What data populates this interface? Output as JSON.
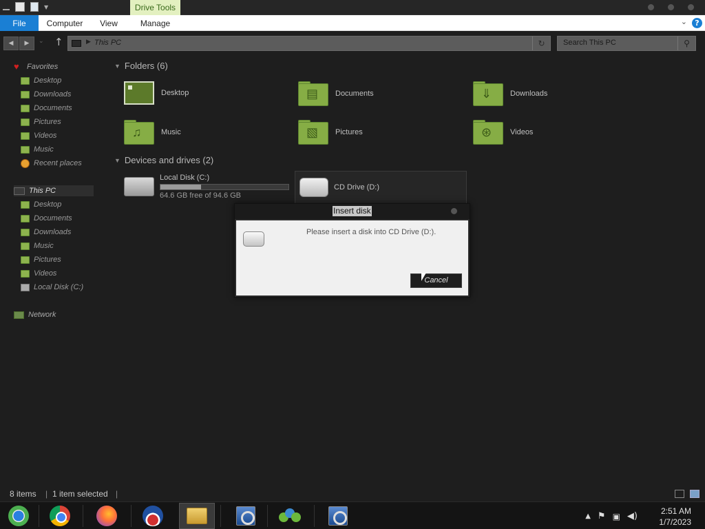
{
  "ribbon": {
    "contextual_tab": "Drive Tools",
    "tabs": [
      "File",
      "Computer",
      "View",
      "Manage"
    ],
    "help_icon": "help-icon"
  },
  "address": {
    "path": "This PC",
    "refresh_icon": "refresh-icon"
  },
  "search": {
    "placeholder": "Search This PC"
  },
  "navpane": {
    "favorites": {
      "label": "Favorites",
      "items": [
        "Desktop",
        "Downloads",
        "Documents",
        "Pictures",
        "Videos",
        "Music",
        "Recent places"
      ]
    },
    "this_pc": {
      "label": "This PC",
      "items": [
        "Desktop",
        "Documents",
        "Downloads",
        "Music",
        "Pictures",
        "Videos",
        "Local Disk (C:)"
      ]
    },
    "network": {
      "label": "Network"
    }
  },
  "folders": {
    "header": "Folders (6)",
    "items": [
      "Desktop",
      "Documents",
      "Downloads",
      "Music",
      "Pictures",
      "Videos"
    ]
  },
  "drives": {
    "header": "Devices and drives (2)",
    "local": {
      "name": "Local Disk (C:)",
      "free": "64.6 GB free of 94.6 GB",
      "used_fraction": 0.317
    },
    "cd": {
      "name": "CD Drive (D:)"
    }
  },
  "dialog": {
    "title": "Insert disk",
    "message": "Please insert a disk into CD Drive (D:).",
    "cancel": "Cancel"
  },
  "status": {
    "item_count": "8 items",
    "selected": "1 item selected"
  },
  "taskbar": {
    "apps": [
      "chromeos-icon",
      "chrome-icon",
      "firefox-icon",
      "obama-icon",
      "file-explorer-icon",
      "setup-icon",
      "people-icon",
      "setup-icon"
    ],
    "clock_time": "2:51 AM",
    "clock_date": "1/7/2023"
  },
  "colors": {
    "accent": "#1a7fd4",
    "folder_green": "#86ad45",
    "contextual_tab_bg": "#e3f0c0"
  }
}
